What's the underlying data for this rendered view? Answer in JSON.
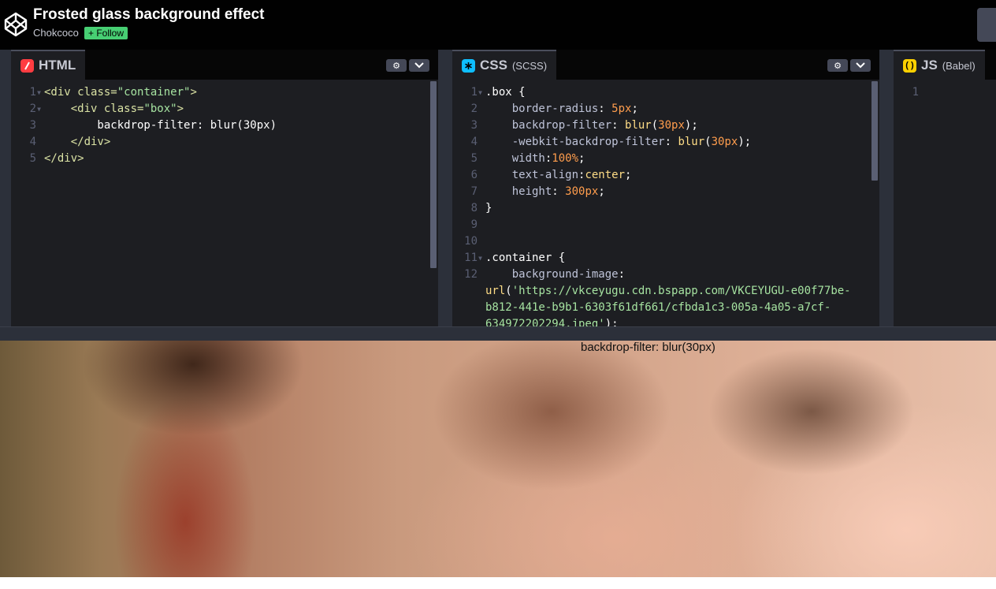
{
  "header": {
    "title": "Frosted glass background effect",
    "author": "Chokcoco",
    "follow_label": "+ Follow"
  },
  "html_pane": {
    "tab_name": "HTML",
    "tab_icon": "html-icon",
    "lines": [
      {
        "num": "1",
        "fold": true,
        "parts": [
          [
            "t-tag",
            "<div "
          ],
          [
            "t-attr",
            "class="
          ],
          [
            "t-str",
            "\"container\""
          ],
          [
            "t-tag",
            ">"
          ]
        ]
      },
      {
        "num": "2",
        "fold": true,
        "parts": [
          [
            "t-tag",
            "    <div "
          ],
          [
            "t-attr",
            "class="
          ],
          [
            "t-str",
            "\"box\""
          ],
          [
            "t-tag",
            ">"
          ]
        ]
      },
      {
        "num": "3",
        "fold": false,
        "parts": [
          [
            "txt",
            "        backdrop-filter: blur(30px)"
          ]
        ]
      },
      {
        "num": "4",
        "fold": false,
        "parts": [
          [
            "t-tag",
            "    </div>"
          ]
        ]
      },
      {
        "num": "5",
        "fold": false,
        "parts": [
          [
            "t-tag",
            "</div>"
          ]
        ]
      }
    ]
  },
  "css_pane": {
    "tab_name": "CSS",
    "tab_sub": "(SCSS)",
    "tab_icon": "css-icon",
    "lines": [
      {
        "num": "1",
        "fold": true,
        "parts": [
          [
            "t-sel",
            ".box {"
          ]
        ]
      },
      {
        "num": "2",
        "fold": false,
        "parts": [
          [
            "t-prop",
            "    border-radius"
          ],
          [
            "txt",
            ": "
          ],
          [
            "t-num",
            "5px"
          ],
          [
            "txt",
            ";"
          ]
        ]
      },
      {
        "num": "3",
        "fold": false,
        "parts": [
          [
            "t-prop",
            "    backdrop-filter"
          ],
          [
            "txt",
            ": "
          ],
          [
            "t-val",
            "blur"
          ],
          [
            "txt",
            "("
          ],
          [
            "t-num",
            "30px"
          ],
          [
            "txt",
            ");"
          ]
        ]
      },
      {
        "num": "4",
        "fold": false,
        "parts": [
          [
            "t-prop",
            "    -webkit-backdrop-filter"
          ],
          [
            "txt",
            ": "
          ],
          [
            "t-val",
            "blur"
          ],
          [
            "txt",
            "("
          ],
          [
            "t-num",
            "30px"
          ],
          [
            "txt",
            ");"
          ]
        ]
      },
      {
        "num": "5",
        "fold": false,
        "parts": [
          [
            "t-prop",
            "    width"
          ],
          [
            "txt",
            ":"
          ],
          [
            "t-num",
            "100%"
          ],
          [
            "txt",
            ";"
          ]
        ]
      },
      {
        "num": "6",
        "fold": false,
        "parts": [
          [
            "t-prop",
            "    text-align"
          ],
          [
            "txt",
            ":"
          ],
          [
            "t-val",
            "center"
          ],
          [
            "txt",
            ";"
          ]
        ]
      },
      {
        "num": "7",
        "fold": false,
        "parts": [
          [
            "t-prop",
            "    height"
          ],
          [
            "txt",
            ": "
          ],
          [
            "t-num",
            "300px"
          ],
          [
            "txt",
            ";"
          ]
        ]
      },
      {
        "num": "8",
        "fold": false,
        "parts": [
          [
            "txt",
            "}"
          ]
        ]
      },
      {
        "num": "9",
        "fold": false,
        "parts": [
          [
            "txt",
            ""
          ]
        ]
      },
      {
        "num": "10",
        "fold": false,
        "parts": [
          [
            "txt",
            ""
          ]
        ]
      },
      {
        "num": "11",
        "fold": true,
        "parts": [
          [
            "t-sel",
            ".container {"
          ]
        ]
      },
      {
        "num": "12",
        "fold": false,
        "parts": [
          [
            "t-prop",
            "    background-image"
          ],
          [
            "txt",
            ":"
          ]
        ]
      },
      {
        "num": "",
        "fold": false,
        "parts": [
          [
            "t-val",
            "url"
          ],
          [
            "txt",
            "("
          ],
          [
            "t-str",
            "'https://vkceyugu.cdn.bspapp.com/VKCEYUGU-e00f77be-"
          ]
        ]
      },
      {
        "num": "",
        "fold": false,
        "parts": [
          [
            "t-str",
            "b812-441e-b9b1-6303f61df661/cfbda1c3-005a-4a05-a7cf-"
          ]
        ]
      },
      {
        "num": "",
        "fold": false,
        "parts": [
          [
            "t-str",
            "634972202294.jpeg'"
          ],
          [
            "txt",
            ");"
          ]
        ]
      }
    ]
  },
  "js_pane": {
    "tab_name": "JS",
    "tab_sub": "(Babel)",
    "tab_icon": "js-icon",
    "lines": [
      {
        "num": "1",
        "fold": false,
        "parts": [
          [
            "txt",
            ""
          ]
        ]
      }
    ]
  },
  "result": {
    "label": "backdrop-filter: blur(30px)"
  },
  "colors": {
    "follow": "#47cf73",
    "html_icon": "#ff3c41",
    "css_icon": "#0ebeff",
    "js_icon": "#fcd000"
  }
}
